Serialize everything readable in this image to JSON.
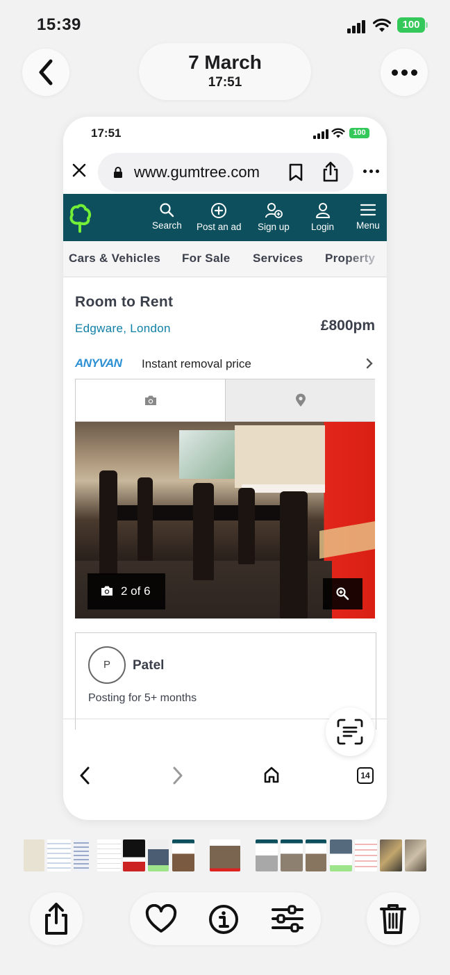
{
  "status": {
    "time": "15:39",
    "battery": "100"
  },
  "header": {
    "date": "7 March",
    "time": "17:51"
  },
  "phone": {
    "status": {
      "time": "17:51",
      "battery": "100"
    },
    "url": "www.gumtree.com",
    "nav": [
      {
        "label": "Search",
        "icon": "search-icon"
      },
      {
        "label": "Post an ad",
        "icon": "plus-circle-icon"
      },
      {
        "label": "Sign up",
        "icon": "add-user-icon"
      },
      {
        "label": "Login",
        "icon": "user-icon"
      },
      {
        "label": "Menu",
        "icon": "hamburger-icon"
      }
    ],
    "categories": [
      "Cars & Vehicles",
      "For Sale",
      "Services",
      "Property"
    ],
    "listing": {
      "title": "Room to Rent",
      "location": "Edgware, London",
      "price": "£800pm",
      "anyvan_brand": "ANYVAN",
      "anyvan_text": "Instant removal price",
      "photo_counter": "2 of 6"
    },
    "seller": {
      "initial": "P",
      "name": "Patel",
      "posting": "Posting for 5+ months"
    },
    "tab_count": "14"
  },
  "colors": {
    "gumtree_nav": "#0d4f5c",
    "gumtree_logo": "#72ef36",
    "link": "#0e7fa6",
    "battery": "#34c759"
  }
}
